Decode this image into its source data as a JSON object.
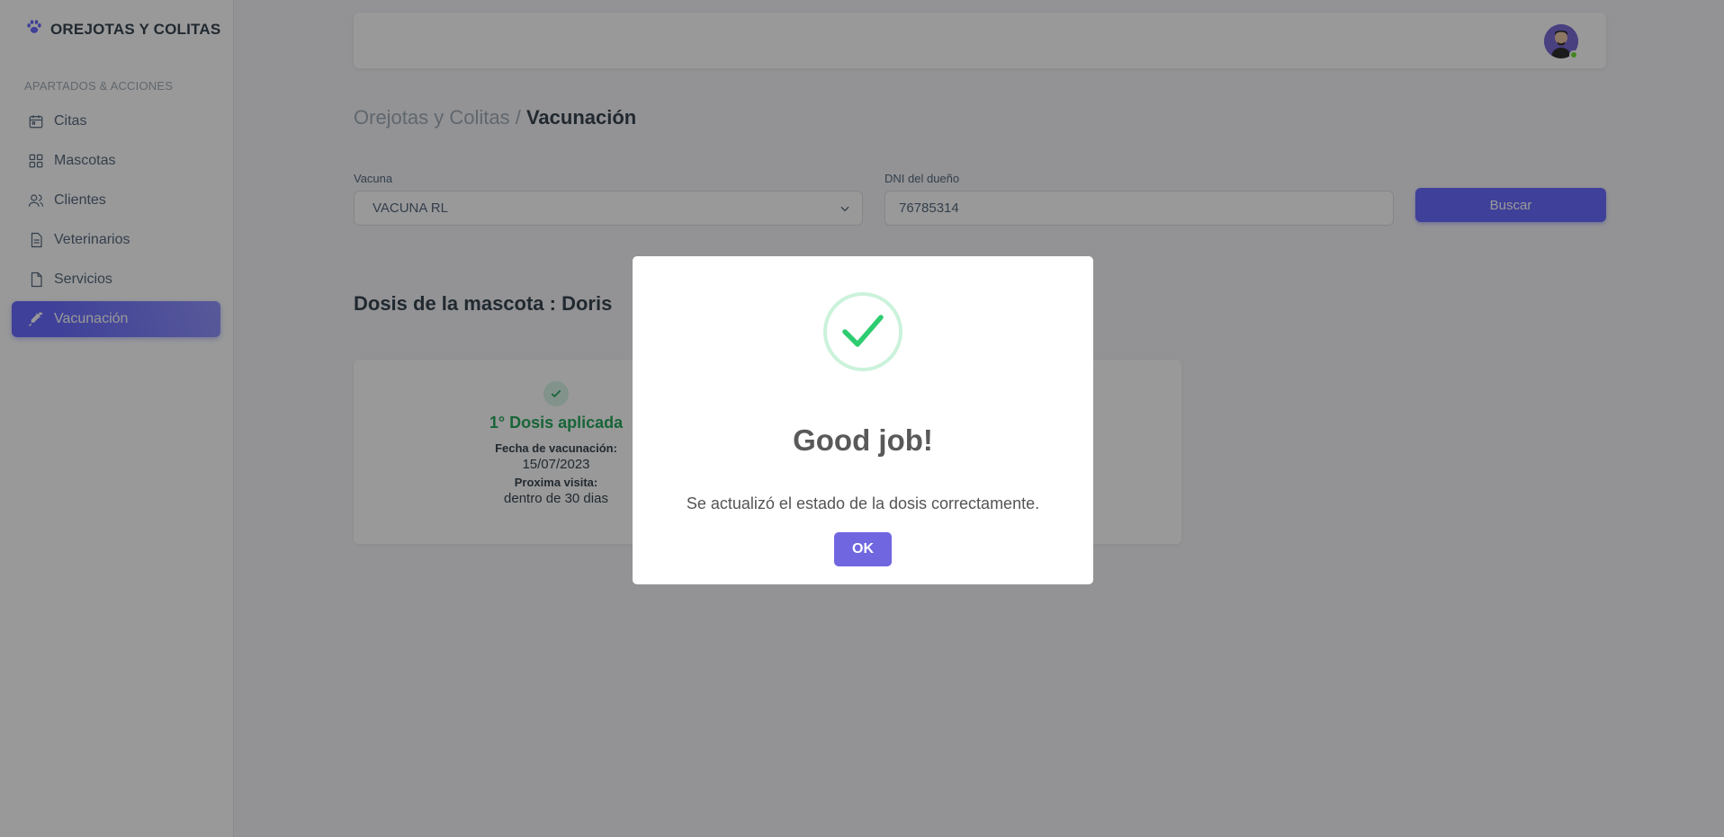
{
  "brand": {
    "name": "OREJOTAS Y COLITAS",
    "icon": "paw-icon"
  },
  "sidebar": {
    "section_header": "APARTADOS & ACCIONES",
    "items": [
      {
        "label": "Citas",
        "icon": "calendar-icon",
        "active": false
      },
      {
        "label": "Mascotas",
        "icon": "grid-icon",
        "active": false
      },
      {
        "label": "Clientes",
        "icon": "users-icon",
        "active": false
      },
      {
        "label": "Veterinarios",
        "icon": "document-icon",
        "active": false
      },
      {
        "label": "Servicios",
        "icon": "file-icon",
        "active": false
      },
      {
        "label": "Vacunación",
        "icon": "syringe-icon",
        "active": true
      }
    ]
  },
  "navbar": {
    "avatar": "user-avatar",
    "status": "online"
  },
  "breadcrumb": {
    "parent": "Orejotas y Colitas /",
    "current": "Vacunación"
  },
  "form": {
    "vaccine_label": "Vacuna",
    "vaccine_value": "VACUNA RL",
    "dni_label": "DNI del dueño",
    "dni_value": "76785314",
    "search_label": "Buscar"
  },
  "doses": {
    "title": "Dosis de la mascota : Doris",
    "items": [
      {
        "status": "1° Dosis aplicada",
        "date_label": "Fecha de vacunación:",
        "date": "15/07/2023",
        "next_label": "Proxima visita:",
        "next": "dentro de 30 dias"
      }
    ]
  },
  "modal": {
    "icon": "success-check-icon",
    "title": "Good job!",
    "message": "Se actualizó el estado de la dosis correctamente.",
    "ok_label": "OK"
  },
  "colors": {
    "primary": "#696cff",
    "success": "#29a85e",
    "swal_confirm": "#7066e0",
    "overlay": "rgba(0,0,0,0.4)"
  }
}
